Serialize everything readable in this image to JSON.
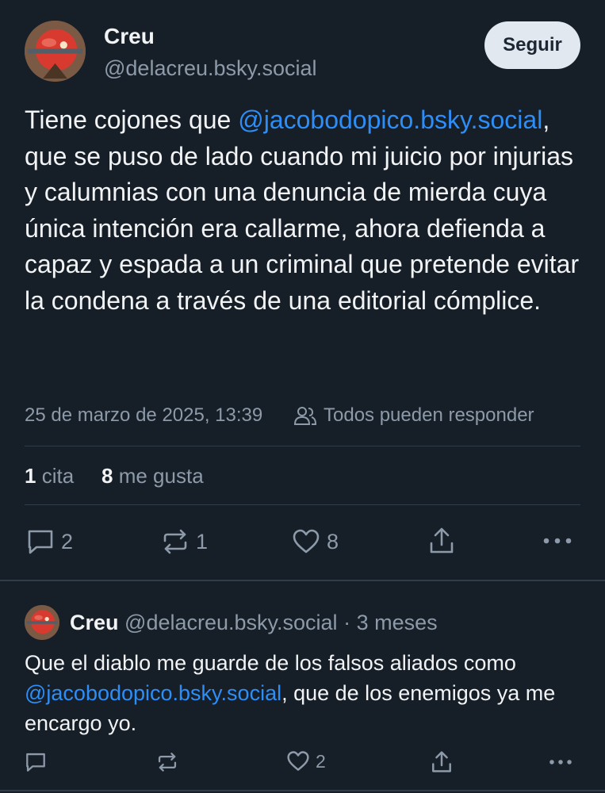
{
  "post": {
    "author_name": "Creu",
    "handle": "@delacreu.bsky.social",
    "follow_label": "Seguir",
    "text_before": "Tiene cojones que ",
    "mention": "@jacobodopico.bsky.social",
    "text_after": ", que se puso de lado cuando mi juicio por injurias y calumnias con una denuncia de mierda cuya única intención era callarme, ahora defienda a capaz y espada a un criminal que pretende evitar la condena a través de una editorial cómplice.",
    "timestamp": "25 de marzo de 2025, 13:39",
    "reply_setting": "Todos pueden responder",
    "quotes_count": "1",
    "quotes_label": "cita",
    "likes_count": "8",
    "likes_label": "me gusta",
    "actions": {
      "replies": "2",
      "reposts": "1",
      "likes": "8"
    }
  },
  "reply": {
    "author_name": "Creu",
    "handle": "@delacreu.bsky.social",
    "age": "· 3 meses",
    "text_before": "Que el diablo me guarde de los falsos aliados como ",
    "mention": "@jacobodopico.bsky.social",
    "text_after": ", que de los enemigos ya me encargo yo.",
    "actions": {
      "likes": "2"
    }
  },
  "colors": {
    "background": "#161e27",
    "link": "#2e8ef7",
    "muted": "#8d9aa9",
    "divider": "#2e3c4b",
    "follow_button_bg": "#e1e8ef"
  }
}
